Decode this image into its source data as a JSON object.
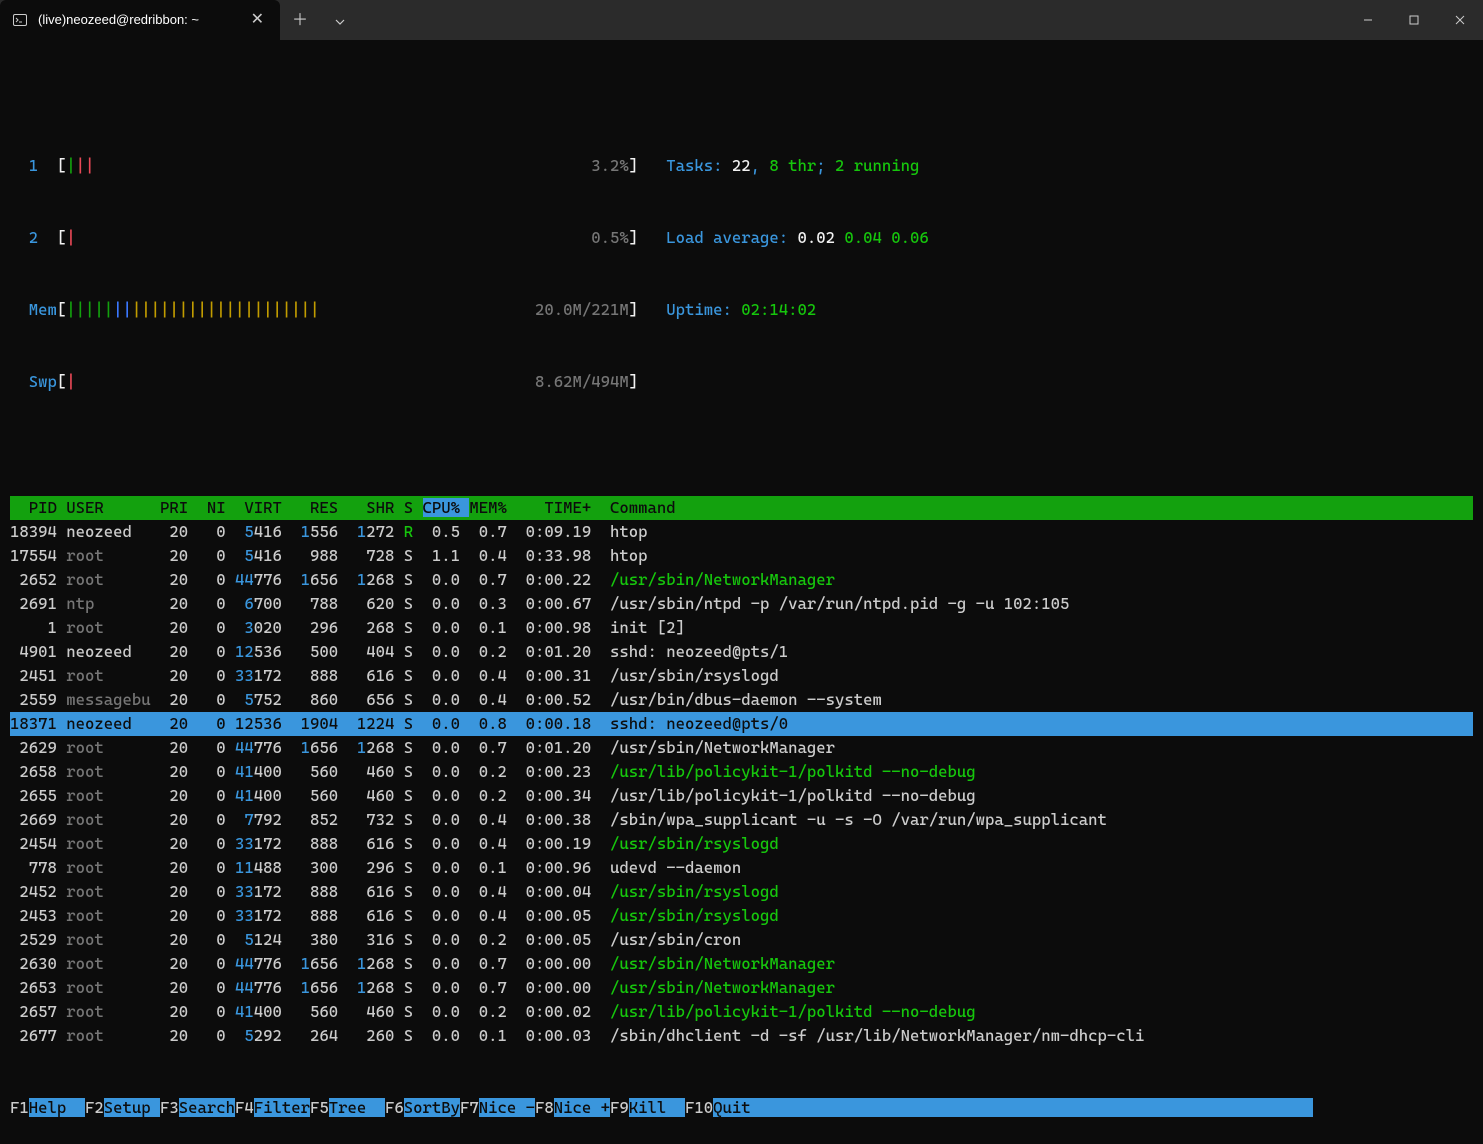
{
  "titlebar": {
    "tab_title": "(live)neozeed@redribbon: ~"
  },
  "meters": {
    "cpu1_label": "1",
    "cpu1_pct": "3.2%",
    "cpu2_label": "2",
    "cpu2_pct": "0.5%",
    "mem_label": "Mem",
    "mem_text": "20.0M/221M",
    "swp_label": "Swp",
    "swp_text": "8.62M/494M",
    "tasks_label": "Tasks: ",
    "tasks_total": "22",
    "tasks_sep": ", ",
    "tasks_thr": "8 thr",
    "tasks_sep2": "; ",
    "tasks_running": "2 running",
    "load_label": "Load average: ",
    "load1": "0.02",
    "load2": "0.04",
    "load3": "0.06",
    "uptime_label": "Uptime: ",
    "uptime_val": "02:14:02"
  },
  "header": {
    "pid": "  PID",
    "user": "USER",
    "pri": "PRI",
    "ni": " NI",
    "virt": " VIRT",
    "res": "  RES",
    "shr": "  SHR",
    "s": "S",
    "cpu": "CPU%",
    "mem": "MEM%",
    "time": "  TIME+",
    "command": " Command"
  },
  "rows": [
    {
      "pid": "18394",
      "user": "neozeed",
      "pri": "20",
      "ni": "0",
      "virt": "5416",
      "res": "1556",
      "shr": "1272",
      "s": "R",
      "cpu": "0.5",
      "mem": "0.7",
      "time": "0:09.19",
      "cmd": "htop",
      "cmdc": "white",
      "virt_fd": "5",
      "res_fd": "1",
      "shr_fd": "1",
      "s_c": "green",
      "user_c": "white"
    },
    {
      "pid": "17554",
      "user": "root",
      "pri": "20",
      "ni": "0",
      "virt": "5416",
      "res": "988",
      "shr": "728",
      "s": "S",
      "cpu": "1.1",
      "mem": "0.4",
      "time": "0:33.98",
      "cmd": "htop",
      "cmdc": "white",
      "virt_fd": "5",
      "user_c": "gray"
    },
    {
      "pid": "2652",
      "user": "root",
      "pri": "20",
      "ni": "0",
      "virt": "44776",
      "res": "1656",
      "shr": "1268",
      "s": "S",
      "cpu": "0.0",
      "mem": "0.7",
      "time": "0:00.22",
      "cmd": "/usr/sbin/NetworkManager",
      "cmdc": "green",
      "virt_fd": "44",
      "res_fd": "1",
      "shr_fd": "1",
      "user_c": "gray"
    },
    {
      "pid": "2691",
      "user": "ntp",
      "pri": "20",
      "ni": "0",
      "virt": "6700",
      "res": "788",
      "shr": "620",
      "s": "S",
      "cpu": "0.0",
      "mem": "0.3",
      "time": "0:00.67",
      "cmd": "/usr/sbin/ntpd -p /var/run/ntpd.pid -g -u 102:105",
      "cmdc": "white",
      "virt_fd": "6",
      "user_c": "gray"
    },
    {
      "pid": "1",
      "user": "root",
      "pri": "20",
      "ni": "0",
      "virt": "3020",
      "res": "296",
      "shr": "268",
      "s": "S",
      "cpu": "0.0",
      "mem": "0.1",
      "time": "0:00.98",
      "cmd": "init [2]",
      "cmdc": "white",
      "virt_fd": "3",
      "user_c": "gray"
    },
    {
      "pid": "4901",
      "user": "neozeed",
      "pri": "20",
      "ni": "0",
      "virt": "12536",
      "res": "500",
      "shr": "404",
      "s": "S",
      "cpu": "0.0",
      "mem": "0.2",
      "time": "0:01.20",
      "cmd": "sshd: neozeed@pts/1",
      "cmdc": "white",
      "virt_fd": "12",
      "user_c": "white"
    },
    {
      "pid": "2451",
      "user": "root",
      "pri": "20",
      "ni": "0",
      "virt": "33172",
      "res": "888",
      "shr": "616",
      "s": "S",
      "cpu": "0.0",
      "mem": "0.4",
      "time": "0:00.31",
      "cmd": "/usr/sbin/rsyslogd",
      "cmdc": "white",
      "virt_fd": "33",
      "user_c": "gray"
    },
    {
      "pid": "2559",
      "user": "messagebu",
      "pri": "20",
      "ni": "0",
      "virt": "5752",
      "res": "860",
      "shr": "656",
      "s": "S",
      "cpu": "0.0",
      "mem": "0.4",
      "time": "0:00.52",
      "cmd": "/usr/bin/dbus-daemon --system",
      "cmdc": "white",
      "virt_fd": "5",
      "user_c": "gray"
    },
    {
      "sel": true,
      "pid": "18371",
      "user": "neozeed",
      "pri": "20",
      "ni": "0",
      "virt": "12536",
      "res": "1904",
      "shr": "1224",
      "s": "S",
      "cpu": "0.0",
      "mem": "0.8",
      "time": "0:00.18",
      "cmd": "sshd: neozeed@pts/0"
    },
    {
      "pid": "2629",
      "user": "root",
      "pri": "20",
      "ni": "0",
      "virt": "44776",
      "res": "1656",
      "shr": "1268",
      "s": "S",
      "cpu": "0.0",
      "mem": "0.7",
      "time": "0:01.20",
      "cmd": "/usr/sbin/NetworkManager",
      "cmdc": "white",
      "virt_fd": "44",
      "res_fd": "1",
      "shr_fd": "1",
      "user_c": "gray"
    },
    {
      "pid": "2658",
      "user": "root",
      "pri": "20",
      "ni": "0",
      "virt": "41400",
      "res": "560",
      "shr": "460",
      "s": "S",
      "cpu": "0.0",
      "mem": "0.2",
      "time": "0:00.23",
      "cmd": "/usr/lib/policykit-1/polkitd --no-debug",
      "cmdc": "green",
      "virt_fd": "41",
      "user_c": "gray"
    },
    {
      "pid": "2655",
      "user": "root",
      "pri": "20",
      "ni": "0",
      "virt": "41400",
      "res": "560",
      "shr": "460",
      "s": "S",
      "cpu": "0.0",
      "mem": "0.2",
      "time": "0:00.34",
      "cmd": "/usr/lib/policykit-1/polkitd --no-debug",
      "cmdc": "white",
      "virt_fd": "41",
      "user_c": "gray"
    },
    {
      "pid": "2669",
      "user": "root",
      "pri": "20",
      "ni": "0",
      "virt": "7792",
      "res": "852",
      "shr": "732",
      "s": "S",
      "cpu": "0.0",
      "mem": "0.4",
      "time": "0:00.38",
      "cmd": "/sbin/wpa_supplicant -u -s -O /var/run/wpa_supplicant",
      "cmdc": "white",
      "virt_fd": "7",
      "user_c": "gray"
    },
    {
      "pid": "2454",
      "user": "root",
      "pri": "20",
      "ni": "0",
      "virt": "33172",
      "res": "888",
      "shr": "616",
      "s": "S",
      "cpu": "0.0",
      "mem": "0.4",
      "time": "0:00.19",
      "cmd": "/usr/sbin/rsyslogd",
      "cmdc": "green",
      "virt_fd": "33",
      "user_c": "gray"
    },
    {
      "pid": "778",
      "user": "root",
      "pri": "20",
      "ni": "0",
      "virt": "11488",
      "res": "300",
      "shr": "296",
      "s": "S",
      "cpu": "0.0",
      "mem": "0.1",
      "time": "0:00.96",
      "cmd": "udevd --daemon",
      "cmdc": "white",
      "virt_fd": "11",
      "user_c": "gray"
    },
    {
      "pid": "2452",
      "user": "root",
      "pri": "20",
      "ni": "0",
      "virt": "33172",
      "res": "888",
      "shr": "616",
      "s": "S",
      "cpu": "0.0",
      "mem": "0.4",
      "time": "0:00.04",
      "cmd": "/usr/sbin/rsyslogd",
      "cmdc": "green",
      "virt_fd": "33",
      "user_c": "gray"
    },
    {
      "pid": "2453",
      "user": "root",
      "pri": "20",
      "ni": "0",
      "virt": "33172",
      "res": "888",
      "shr": "616",
      "s": "S",
      "cpu": "0.0",
      "mem": "0.4",
      "time": "0:00.05",
      "cmd": "/usr/sbin/rsyslogd",
      "cmdc": "green",
      "virt_fd": "33",
      "user_c": "gray"
    },
    {
      "pid": "2529",
      "user": "root",
      "pri": "20",
      "ni": "0",
      "virt": "5124",
      "res": "380",
      "shr": "316",
      "s": "S",
      "cpu": "0.0",
      "mem": "0.2",
      "time": "0:00.05",
      "cmd": "/usr/sbin/cron",
      "cmdc": "white",
      "virt_fd": "5",
      "user_c": "gray"
    },
    {
      "pid": "2630",
      "user": "root",
      "pri": "20",
      "ni": "0",
      "virt": "44776",
      "res": "1656",
      "shr": "1268",
      "s": "S",
      "cpu": "0.0",
      "mem": "0.7",
      "time": "0:00.00",
      "cmd": "/usr/sbin/NetworkManager",
      "cmdc": "green",
      "virt_fd": "44",
      "res_fd": "1",
      "shr_fd": "1",
      "user_c": "gray"
    },
    {
      "pid": "2653",
      "user": "root",
      "pri": "20",
      "ni": "0",
      "virt": "44776",
      "res": "1656",
      "shr": "1268",
      "s": "S",
      "cpu": "0.0",
      "mem": "0.7",
      "time": "0:00.00",
      "cmd": "/usr/sbin/NetworkManager",
      "cmdc": "green",
      "virt_fd": "44",
      "res_fd": "1",
      "shr_fd": "1",
      "user_c": "gray"
    },
    {
      "pid": "2657",
      "user": "root",
      "pri": "20",
      "ni": "0",
      "virt": "41400",
      "res": "560",
      "shr": "460",
      "s": "S",
      "cpu": "0.0",
      "mem": "0.2",
      "time": "0:00.02",
      "cmd": "/usr/lib/policykit-1/polkitd --no-debug",
      "cmdc": "green",
      "virt_fd": "41",
      "user_c": "gray"
    },
    {
      "pid": "2677",
      "user": "root",
      "pri": "20",
      "ni": "0",
      "virt": "5292",
      "res": "264",
      "shr": "260",
      "s": "S",
      "cpu": "0.0",
      "mem": "0.1",
      "time": "0:00.03",
      "cmd": "/sbin/dhclient -d -sf /usr/lib/NetworkManager/nm-dhcp-cli",
      "cmdc": "white",
      "virt_fd": "5",
      "user_c": "gray"
    }
  ],
  "fkeys": [
    {
      "k": "F1",
      "l": "Help  "
    },
    {
      "k": "F2",
      "l": "Setup "
    },
    {
      "k": "F3",
      "l": "Search"
    },
    {
      "k": "F4",
      "l": "Filter"
    },
    {
      "k": "F5",
      "l": "Tree  "
    },
    {
      "k": "F6",
      "l": "SortBy"
    },
    {
      "k": "F7",
      "l": "Nice -"
    },
    {
      "k": "F8",
      "l": "Nice +"
    },
    {
      "k": "F9",
      "l": "Kill  "
    },
    {
      "k": "F10",
      "l": "Quit"
    }
  ]
}
